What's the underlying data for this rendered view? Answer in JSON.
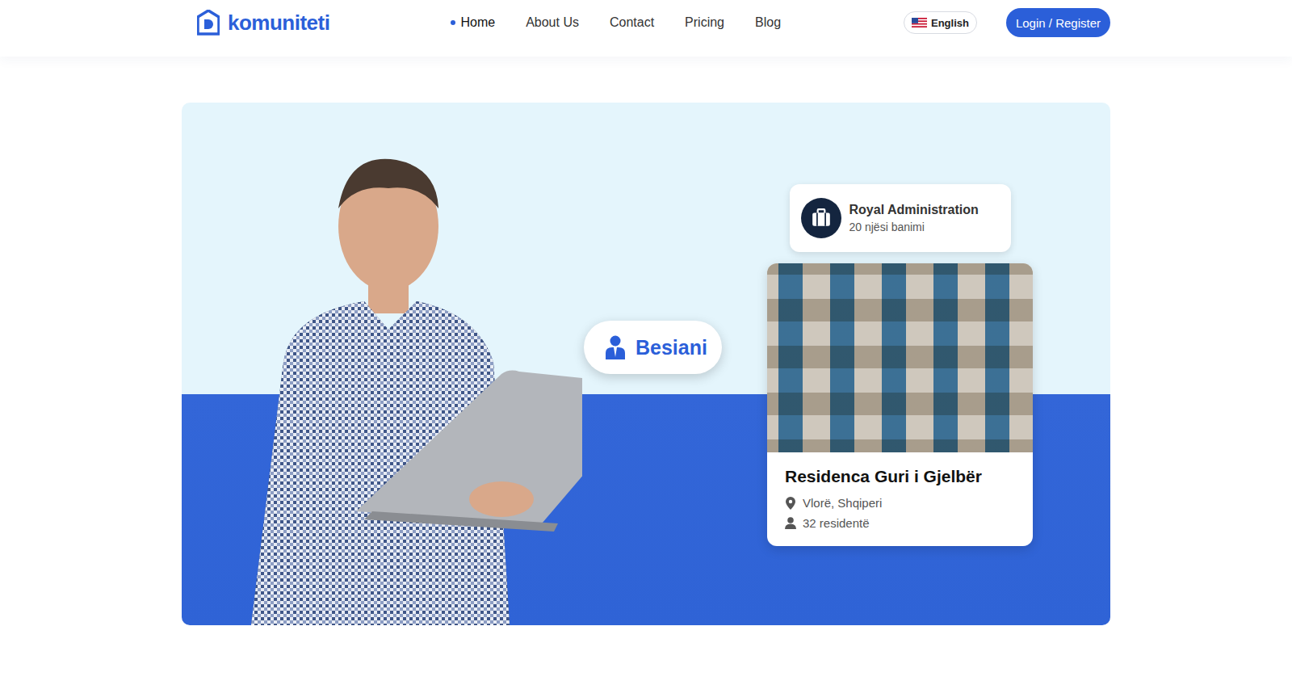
{
  "logo": {
    "text": "komuniteti"
  },
  "nav": [
    {
      "label": "Home",
      "selected": true
    },
    {
      "label": "About Us",
      "selected": false
    },
    {
      "label": "Contact",
      "selected": false
    },
    {
      "label": "Pricing",
      "selected": false
    },
    {
      "label": "Blog",
      "selected": false
    }
  ],
  "language": {
    "label": "English"
  },
  "login_button": {
    "label": "Login / Register"
  },
  "hero": {
    "user_badge": {
      "name": "Besiani"
    },
    "admin_card": {
      "name": "Royal Administration",
      "units": "20 njësi banimi"
    },
    "property_card": {
      "name": "Residenca Guri i Gjelbër",
      "location": "Vlorë, Shqiperi",
      "residents": "32 residentë"
    }
  }
}
